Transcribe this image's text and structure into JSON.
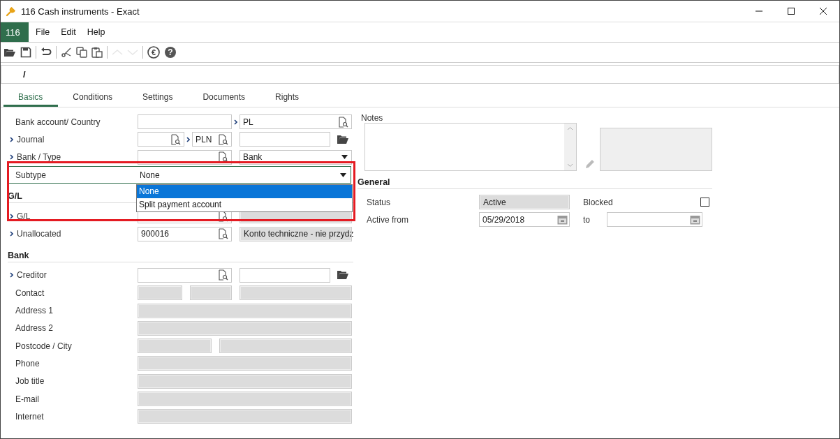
{
  "window": {
    "title": "116 Cash instruments - Exact"
  },
  "menu": {
    "badge": "116",
    "items": [
      "File",
      "Edit",
      "Help"
    ]
  },
  "toolbar": [
    {
      "kind": "open"
    },
    {
      "kind": "save"
    },
    {
      "kind": "sep"
    },
    {
      "kind": "undo"
    },
    {
      "kind": "sep"
    },
    {
      "kind": "cut"
    },
    {
      "kind": "copy"
    },
    {
      "kind": "paste"
    },
    {
      "kind": "sep"
    },
    {
      "kind": "up",
      "disabled": true
    },
    {
      "kind": "down",
      "disabled": true
    },
    {
      "kind": "sep"
    },
    {
      "kind": "euro",
      "glyph": "€"
    },
    {
      "kind": "help",
      "glyph": "?"
    }
  ],
  "path_field": {
    "value": "/"
  },
  "tabs": [
    {
      "label": "Basics",
      "selected": true
    },
    {
      "label": "Conditions",
      "selected": false
    },
    {
      "label": "Settings",
      "selected": false
    },
    {
      "label": "Documents",
      "selected": false
    },
    {
      "label": "Rights",
      "selected": false
    }
  ],
  "sections": [
    {
      "rows": [
        {
          "label": "Bank account/ Country",
          "link": false,
          "kind": "pair",
          "fields": [
            {
              "kind": "text"
            },
            {
              "kind": "lookup",
              "link": true,
              "value": "PL"
            }
          ]
        },
        {
          "label": "Journal",
          "link": true,
          "kind": "journal",
          "fields": [
            {
              "kind": "lookup"
            },
            {
              "kind": "lookup",
              "link": true,
              "value": "PLN"
            },
            {
              "kind": "text",
              "folder": true
            }
          ]
        },
        {
          "label": "Bank / Type",
          "link": true,
          "kind": "pair",
          "fields": [
            {
              "kind": "lookup"
            },
            {
              "kind": "select",
              "value": "Bank"
            }
          ]
        },
        {
          "label": "Subtype",
          "link": false,
          "kind": "wide",
          "focused": true,
          "highlighted": true,
          "fields": [
            {
              "kind": "select",
              "value": "None",
              "options": [
                {
                  "label": "None",
                  "selected": true
                },
                {
                  "label": "Split payment account",
                  "selected": false
                }
              ]
            }
          ]
        }
      ]
    },
    {
      "heading": "G/L",
      "rows": [
        {
          "label": "G/L",
          "link": true,
          "kind": "pair",
          "fields": [
            {
              "kind": "lookup"
            },
            {
              "kind": "readonly"
            }
          ]
        },
        {
          "label": "Unallocated",
          "link": true,
          "kind": "pair",
          "fields": [
            {
              "kind": "lookup",
              "value": "900016"
            },
            {
              "kind": "readonly",
              "value": "Konto techniczne - nie przydz"
            }
          ]
        }
      ]
    },
    {
      "heading": "Bank",
      "rows": [
        {
          "label": "Creditor",
          "link": true,
          "kind": "pair",
          "fields": [
            {
              "kind": "lookup"
            },
            {
              "kind": "text",
              "folder": true
            }
          ]
        },
        {
          "label": "Contact",
          "link": false,
          "kind": "contact",
          "fields": [
            {
              "kind": "readonly"
            },
            {
              "kind": "readonly"
            },
            {
              "kind": "readonly"
            }
          ]
        },
        {
          "label": "Address 1",
          "link": false,
          "kind": "wide",
          "fields": [
            {
              "kind": "readonly"
            }
          ]
        },
        {
          "label": "Address 2",
          "link": false,
          "kind": "wide",
          "fields": [
            {
              "kind": "readonly"
            }
          ]
        },
        {
          "label": "Postcode / City",
          "link": false,
          "kind": "postcode",
          "fields": [
            {
              "kind": "readonly"
            },
            {
              "kind": "readonly"
            }
          ]
        },
        {
          "label": "Phone",
          "link": false,
          "kind": "wide",
          "fields": [
            {
              "kind": "readonly"
            }
          ]
        },
        {
          "label": "Job title",
          "link": false,
          "kind": "wide",
          "fields": [
            {
              "kind": "readonly"
            }
          ]
        },
        {
          "label": "E-mail",
          "link": false,
          "kind": "wide",
          "fields": [
            {
              "kind": "readonly"
            }
          ]
        },
        {
          "label": "Internet",
          "link": false,
          "kind": "wide",
          "fields": [
            {
              "kind": "readonly"
            }
          ]
        }
      ]
    }
  ],
  "notes": {
    "label": "Notes"
  },
  "general": {
    "heading": "General",
    "status": {
      "label": "Status",
      "value": "Active"
    },
    "blocked": {
      "label": "Blocked",
      "checked": false
    },
    "active_from": {
      "label": "Active from",
      "value": "05/29/2018"
    },
    "to": {
      "label": "to"
    }
  }
}
